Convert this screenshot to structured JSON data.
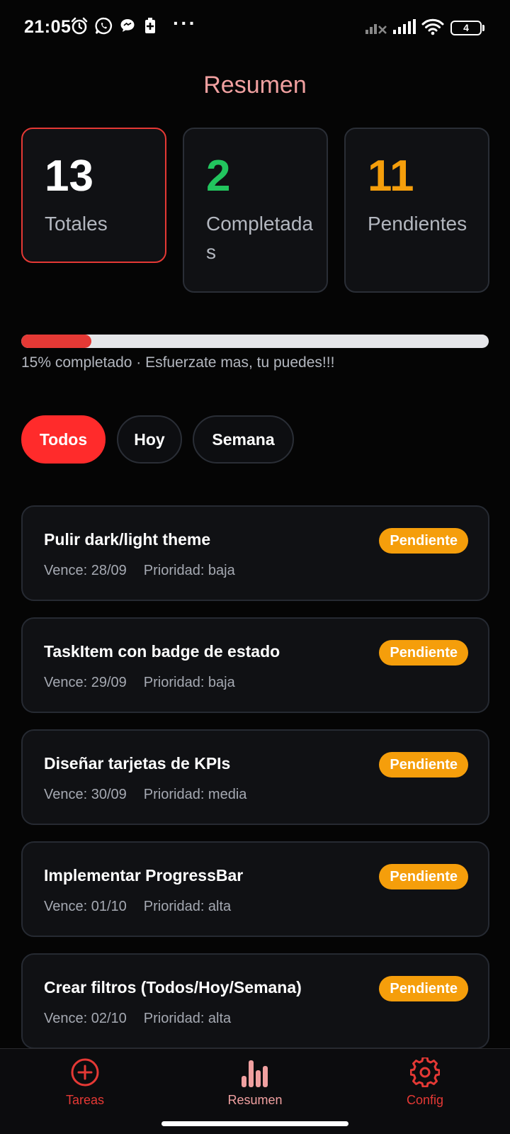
{
  "status_bar": {
    "time": "21:05",
    "more": "···",
    "battery": "4",
    "icons": [
      "alarm-icon",
      "whatsapp-icon",
      "chat-bubble-icon",
      "battery-saver-icon",
      "signal-off-icon",
      "signal-icon",
      "wifi-icon",
      "battery-icon"
    ]
  },
  "header": {
    "title": "Resumen"
  },
  "kpis": [
    {
      "value": "13",
      "label": "Totales",
      "color": "#ffffff"
    },
    {
      "value": "2",
      "label": "Completadas",
      "color": "#22c55e"
    },
    {
      "value": "11",
      "label": "Pendientes",
      "color": "#f59e0b"
    }
  ],
  "progress": {
    "percent": 15,
    "text": "15% completado · Esfuerzate mas, tu puedes!!!"
  },
  "filters": [
    "Todos",
    "Hoy",
    "Semana"
  ],
  "tasks": [
    {
      "title": "Pulir dark/light theme",
      "due": "Vence: 28/09",
      "priority": "Prioridad: baja",
      "status": "Pendiente"
    },
    {
      "title": "TaskItem con badge de estado",
      "due": "Vence: 29/09",
      "priority": "Prioridad: baja",
      "status": "Pendiente"
    },
    {
      "title": "Diseñar tarjetas de KPIs",
      "due": "Vence: 30/09",
      "priority": "Prioridad: media",
      "status": "Pendiente"
    },
    {
      "title": "Implementar ProgressBar",
      "due": "Vence: 01/10",
      "priority": "Prioridad: alta",
      "status": "Pendiente"
    },
    {
      "title": "Crear filtros (Todos/Hoy/Semana)",
      "due": "Vence: 02/10",
      "priority": "Prioridad: alta",
      "status": "Pendiente"
    }
  ],
  "bottom_nav": [
    {
      "label": "Tareas",
      "icon": "plus-circle-icon"
    },
    {
      "label": "Resumen",
      "icon": "bar-chart-icon"
    },
    {
      "label": "Config",
      "icon": "gear-icon"
    }
  ],
  "colors": {
    "accent_red": "#e53935",
    "title_pink": "#f0a0a0",
    "pending_amber": "#f59e0b",
    "done_green": "#22c55e"
  }
}
